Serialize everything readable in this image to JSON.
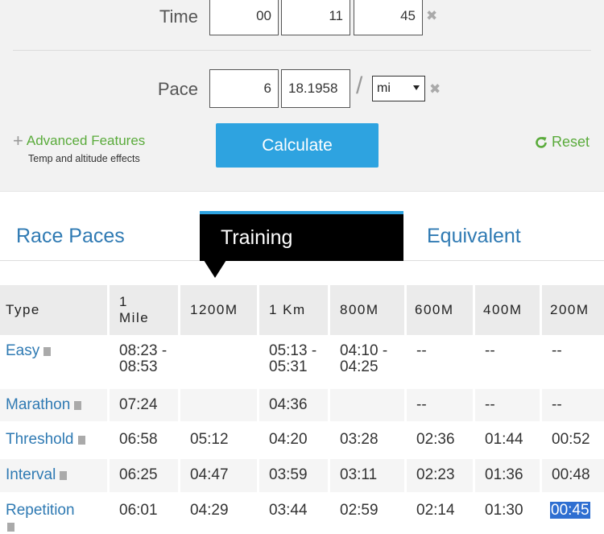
{
  "time": {
    "label": "Time",
    "hours": "00",
    "minutes": "11",
    "seconds": "45"
  },
  "pace": {
    "label": "Pace",
    "minutes": "6",
    "seconds": "18.1958",
    "slash": "/",
    "unit": "mi"
  },
  "clear_symbol": "✖",
  "advanced": {
    "label": "Advanced Features",
    "subtitle": "Temp and altitude effects"
  },
  "calculate_label": "Calculate",
  "reset_label": "Reset",
  "tabs": {
    "race": "Race Paces",
    "training": "Training",
    "equivalent": "Equivalent"
  },
  "table": {
    "headers": [
      "Type",
      "1\nMile",
      "1200M",
      "1 Km",
      "800M",
      "600M",
      "400M",
      "200M"
    ],
    "rows": [
      {
        "type": "Easy",
        "cells": [
          "08:23 -\n08:53",
          "",
          "05:13 -\n05:31",
          "04:10 -\n04:25",
          "--",
          "--",
          "--"
        ]
      },
      {
        "type": "Marathon",
        "cells": [
          "07:24",
          "",
          "04:36",
          "",
          "--",
          "--",
          "--"
        ]
      },
      {
        "type": "Threshold",
        "cells": [
          "06:58",
          "05:12",
          "04:20",
          "03:28",
          "02:36",
          "01:44",
          "00:52"
        ]
      },
      {
        "type": "Interval",
        "cells": [
          "06:25",
          "04:47",
          "03:59",
          "03:11",
          "02:23",
          "01:36",
          "00:48"
        ]
      },
      {
        "type": "Repetition",
        "cells": [
          "06:01",
          "04:29",
          "03:44",
          "02:59",
          "02:14",
          "01:30",
          "00:45"
        ]
      }
    ]
  },
  "colors": {
    "accent_blue": "#2ea3e0",
    "link_blue": "#2f7ab3",
    "green": "#5aab3b",
    "highlight": "#2f6fd1"
  }
}
